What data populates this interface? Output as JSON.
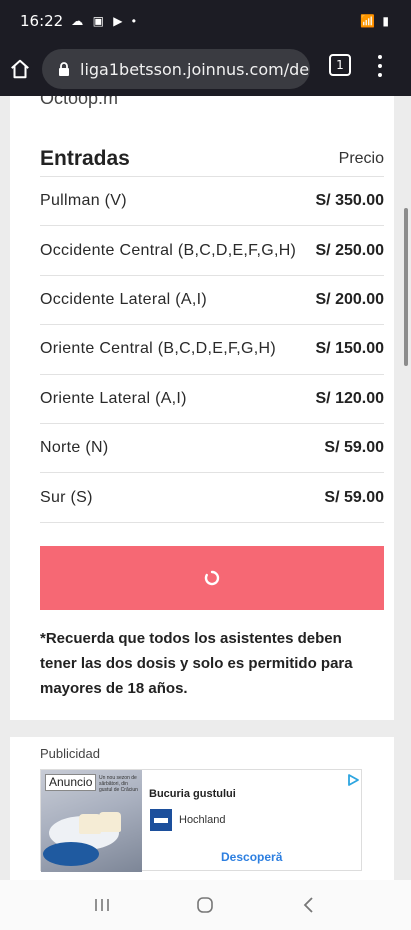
{
  "status_bar": {
    "time": "16:22",
    "left_icons": "☁ ▣ ▶ •",
    "right_icons": "📶 ▮"
  },
  "browser": {
    "url": "liga1betsson.joinnus.com/de",
    "tab_count": "1"
  },
  "cut_off_text": "Octoop.m",
  "tickets": {
    "title": "Entradas",
    "price_header": "Precio",
    "rows": [
      {
        "name": "Pullman (V)",
        "price": "S/ 350.00"
      },
      {
        "name": "Occidente Central (B,C,D,E,F,G,H)",
        "price": "S/ 250.00"
      },
      {
        "name": "Occidente Lateral (A,I)",
        "price": "S/ 200.00"
      },
      {
        "name": "Oriente Central (B,C,D,E,F,G,H)",
        "price": "S/ 150.00"
      },
      {
        "name": "Oriente Lateral (A,I)",
        "price": "S/ 120.00"
      },
      {
        "name": "Norte (N)",
        "price": "S/ 59.00"
      },
      {
        "name": "Sur (S)",
        "price": "S/ 59.00"
      }
    ]
  },
  "note": "*Recuerda que todos los asistentes deben tener las dos dosis y solo es permitido para mayores de 18 años.",
  "colors": {
    "button": "#f66874",
    "status_bar": "#1c1c24",
    "ad_link": "#2d7fe0"
  },
  "ad": {
    "label": "Publicidad",
    "badge": "Anuncio",
    "image_text": "Un nou sezon de sărbători, din gustul de Crăciun",
    "title": "Bucuria gustului",
    "brand": "Hochland",
    "cta": "Descoperă"
  },
  "nav": {
    "recent": "recent-apps",
    "home": "home",
    "back": "back"
  }
}
